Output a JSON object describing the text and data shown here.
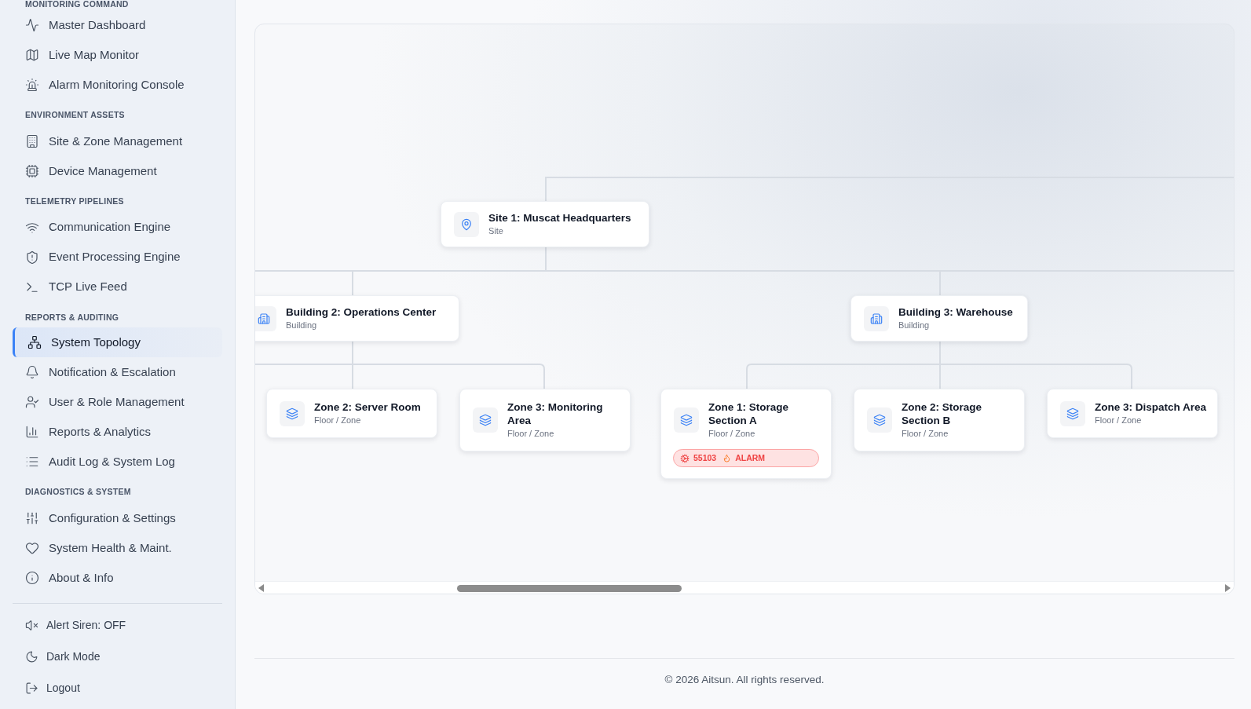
{
  "sidebar": {
    "sections": [
      {
        "title": "MONITORING COMMAND",
        "items": [
          {
            "label": "Master Dashboard",
            "selected": false
          },
          {
            "label": "Live Map Monitor",
            "selected": false
          },
          {
            "label": "Alarm Monitoring Console",
            "selected": false
          }
        ]
      },
      {
        "title": "ENVIRONMENT ASSETS",
        "items": [
          {
            "label": "Site & Zone Management",
            "selected": false
          },
          {
            "label": "Device Management",
            "selected": false
          }
        ]
      },
      {
        "title": "TELEMETRY PIPELINES",
        "items": [
          {
            "label": "Communication Engine",
            "selected": false
          },
          {
            "label": "Event Processing Engine",
            "selected": false
          },
          {
            "label": "TCP Live Feed",
            "selected": false
          }
        ]
      },
      {
        "title": "REPORTS & AUDITING",
        "items": [
          {
            "label": "System Topology",
            "selected": true
          },
          {
            "label": "Notification & Escalation",
            "selected": false
          },
          {
            "label": "User & Role Management",
            "selected": false
          },
          {
            "label": "Reports & Analytics",
            "selected": false
          },
          {
            "label": "Audit Log & System Log",
            "selected": false
          }
        ]
      },
      {
        "title": "DIAGNOSTICS & SYSTEM",
        "items": [
          {
            "label": "Configuration & Settings",
            "selected": false
          },
          {
            "label": "System Health & Maint.",
            "selected": false
          },
          {
            "label": "About & Info",
            "selected": false
          }
        ]
      }
    ],
    "bottom": [
      {
        "kind": "siren",
        "label": "Alert Siren: OFF"
      },
      {
        "kind": "theme",
        "label": "Dark Mode"
      },
      {
        "kind": "logout",
        "label": "Logout"
      }
    ]
  },
  "topology": {
    "nodes": [
      {
        "kind": "site",
        "title": "Site 1: Muscat Headquarters",
        "subtitle": "Site"
      },
      {
        "kind": "building",
        "title": "Building 2: Operations Center",
        "subtitle": "Building"
      },
      {
        "kind": "building",
        "title": "Building 3: Warehouse",
        "subtitle": "Building"
      },
      {
        "kind": "zone",
        "title": "Zone 2: Server Room",
        "subtitle": "Floor / Zone"
      },
      {
        "kind": "zone",
        "title": "Zone 3: Monitoring Area",
        "subtitle": "Floor / Zone"
      },
      {
        "kind": "zone",
        "title": "Zone 1: Storage Section A",
        "subtitle": "Floor / Zone",
        "alarm": {
          "code": "55103",
          "label": "ALARM"
        }
      },
      {
        "kind": "zone",
        "title": "Zone 2: Storage Section B",
        "subtitle": "Floor / Zone"
      },
      {
        "kind": "zone",
        "title": "Zone 3: Dispatch Area",
        "subtitle": "Floor / Zone"
      }
    ]
  },
  "footer": "© 2026 Aitsun. All rights reserved."
}
